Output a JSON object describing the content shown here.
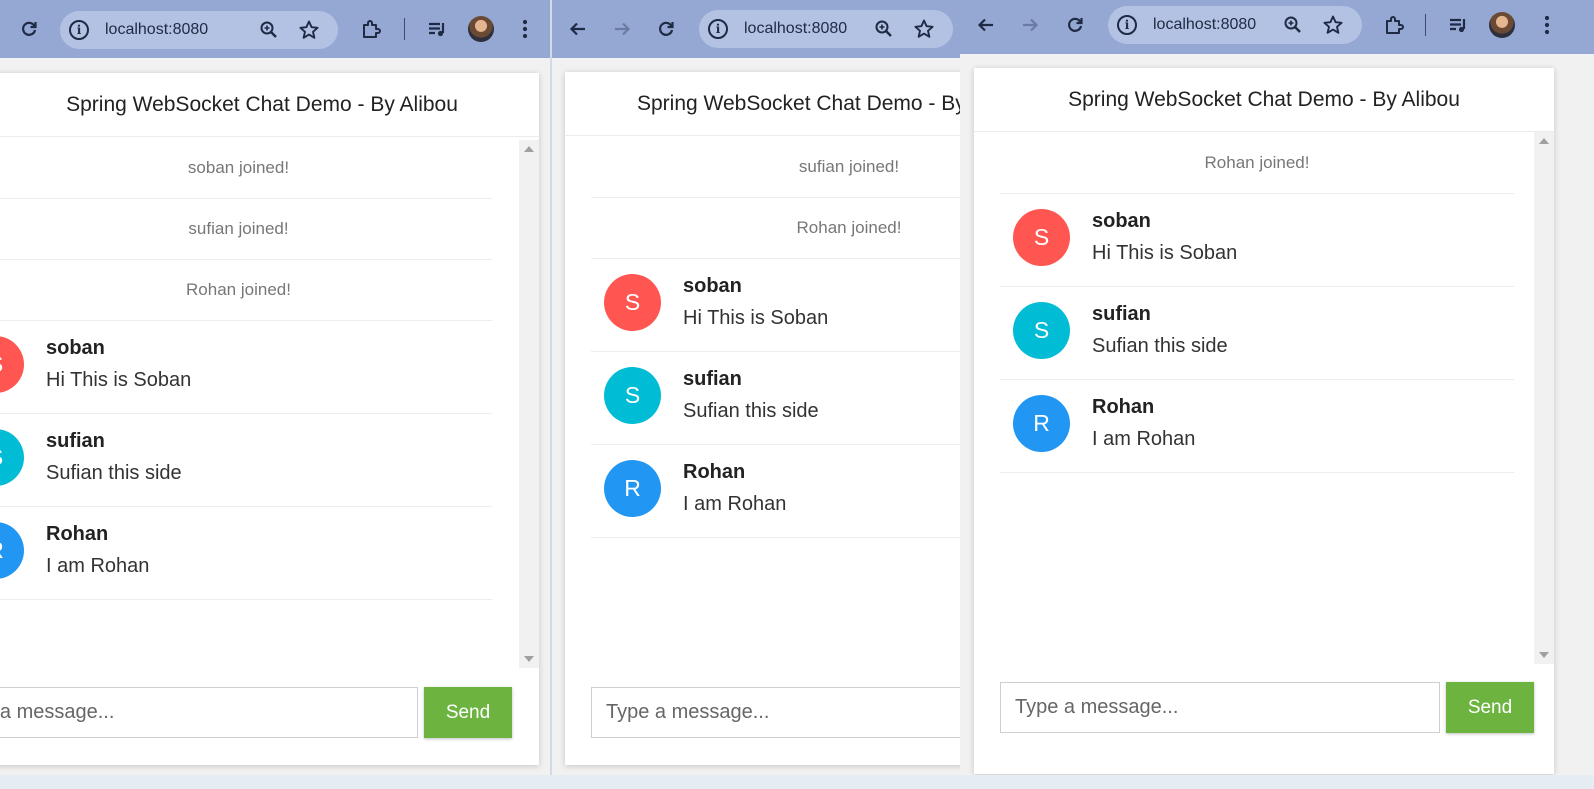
{
  "browser": {
    "url": "localhost:8080",
    "zoom_icon": "zoom-icon",
    "star_icon": "star-icon",
    "extensions_icon": "puzzle-icon",
    "media_icon": "media-queue-icon",
    "menu_icon": "vertical-dots-icon"
  },
  "chat": {
    "title": "Spring WebSocket Chat Demo - By Alibou",
    "input_placeholder": "Type a message...",
    "send_label": "Send"
  },
  "users": [
    {
      "name": "soban",
      "initial": "S",
      "color": "#ff5652"
    },
    {
      "name": "sufian",
      "initial": "S",
      "color": "#00bcd4"
    },
    {
      "name": "Rohan",
      "initial": "R",
      "color": "#2196f3"
    }
  ],
  "messages": [
    {
      "type": "JOIN",
      "text": "soban joined!"
    },
    {
      "type": "JOIN",
      "text": "sufian joined!"
    },
    {
      "type": "JOIN",
      "text": "Rohan joined!"
    },
    {
      "type": "CHAT",
      "sender": "soban",
      "initial": "S",
      "color": "#ff5652",
      "text": "Hi This is Soban"
    },
    {
      "type": "CHAT",
      "sender": "sufian",
      "initial": "S",
      "color": "#00bcd4",
      "text": "Sufian this side"
    },
    {
      "type": "CHAT",
      "sender": "Rohan",
      "initial": "R",
      "color": "#2196f3",
      "text": "I am Rohan"
    }
  ],
  "windows": [
    {
      "label": "window-1",
      "visible_messages": [
        0,
        1,
        2,
        3,
        4,
        5
      ]
    },
    {
      "label": "window-2",
      "visible_messages": [
        1,
        2,
        3,
        4,
        5
      ]
    },
    {
      "label": "window-3",
      "visible_messages": [
        2,
        3,
        4,
        5
      ]
    }
  ]
}
